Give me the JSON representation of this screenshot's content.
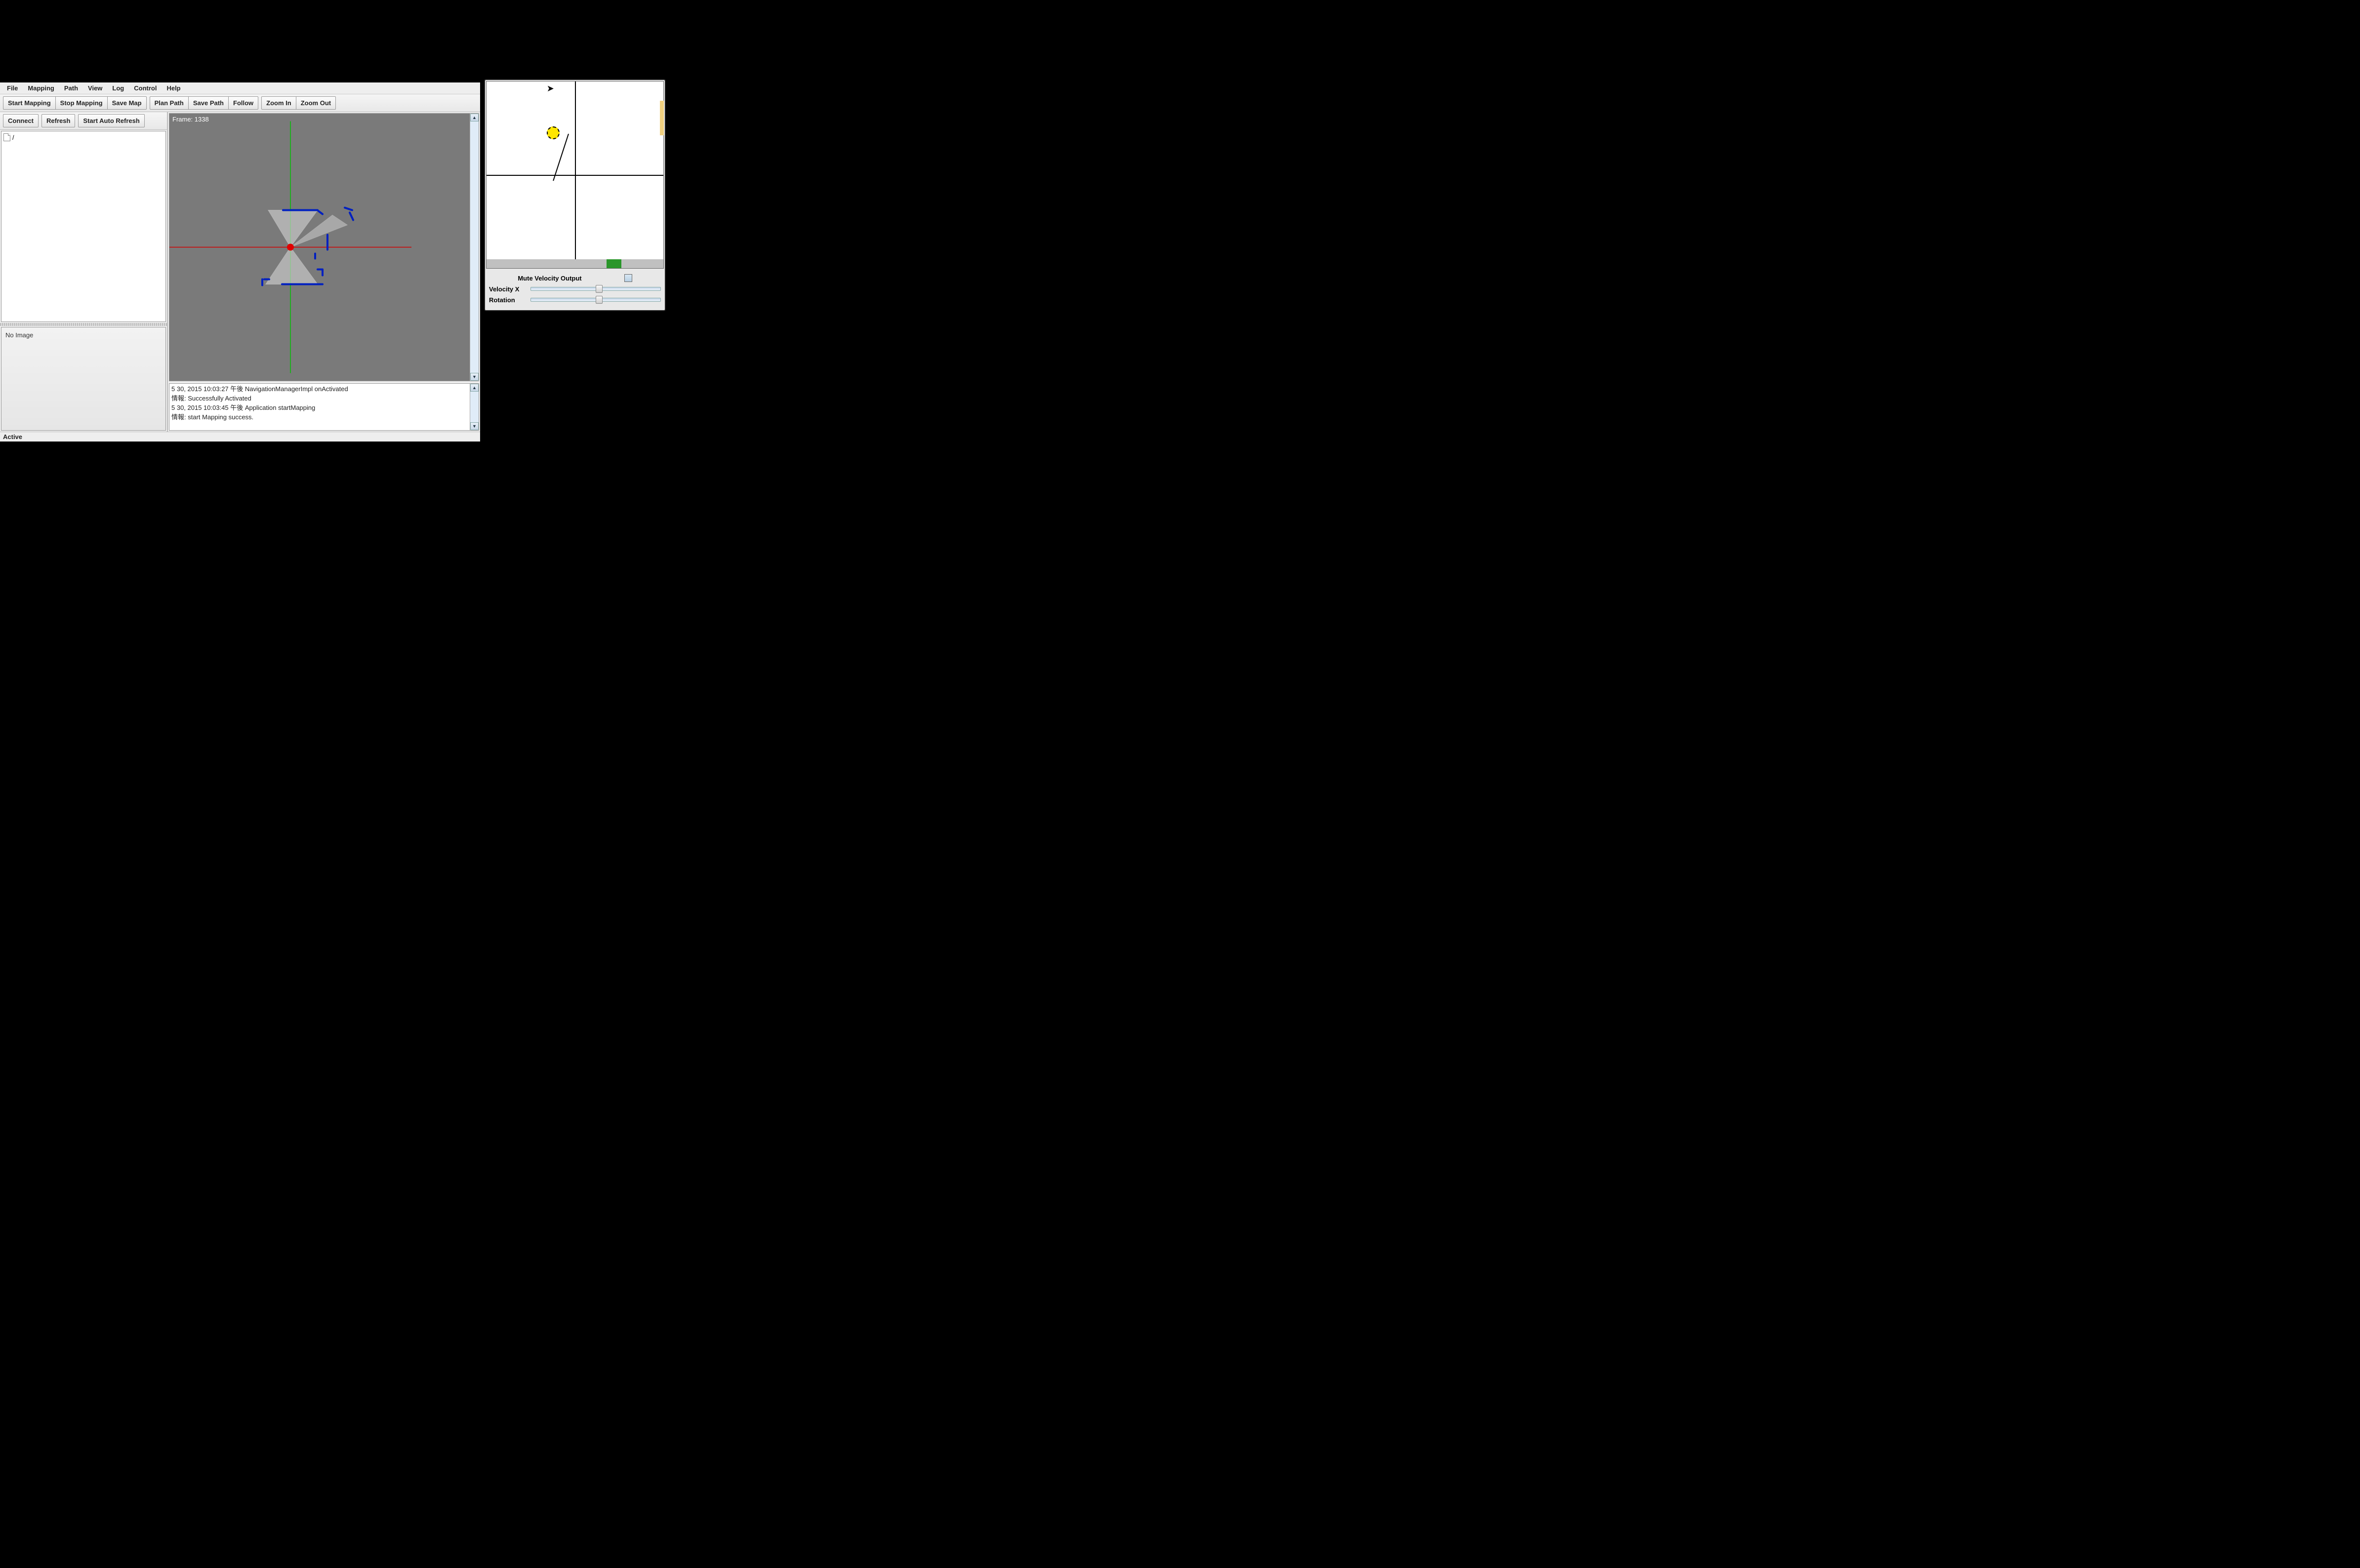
{
  "menu": {
    "file": "File",
    "mapping": "Mapping",
    "path": "Path",
    "view": "View",
    "log": "Log",
    "control": "Control",
    "help": "Help"
  },
  "toolbar": {
    "start_mapping": "Start Mapping",
    "stop_mapping": "Stop Mapping",
    "save_map": "Save Map",
    "plan_path": "Plan Path",
    "save_path": "Save Path",
    "follow": "Follow",
    "zoom_in": "Zoom In",
    "zoom_out": "Zoom Out"
  },
  "left_toolbar": {
    "connect": "Connect",
    "refresh": "Refresh",
    "start_auto_refresh": "Start Auto Refresh"
  },
  "tree": {
    "root_label": "/"
  },
  "image_panel": {
    "no_image": "No Image"
  },
  "map": {
    "frame_label": "Frame: 1338"
  },
  "log": {
    "lines": [
      "5 30, 2015 10:03:27 午後 NavigationManagerImpl onActivated",
      "情報: Successfully Activated",
      "5 30, 2015 10:03:45 午後 Application startMapping",
      "情報: start Mapping success."
    ]
  },
  "status": {
    "text": "Active"
  },
  "velocity_panel": {
    "mute_label": "Mute Velocity Output",
    "velocity_x_label": "Velocity X",
    "rotation_label": "Rotation"
  }
}
